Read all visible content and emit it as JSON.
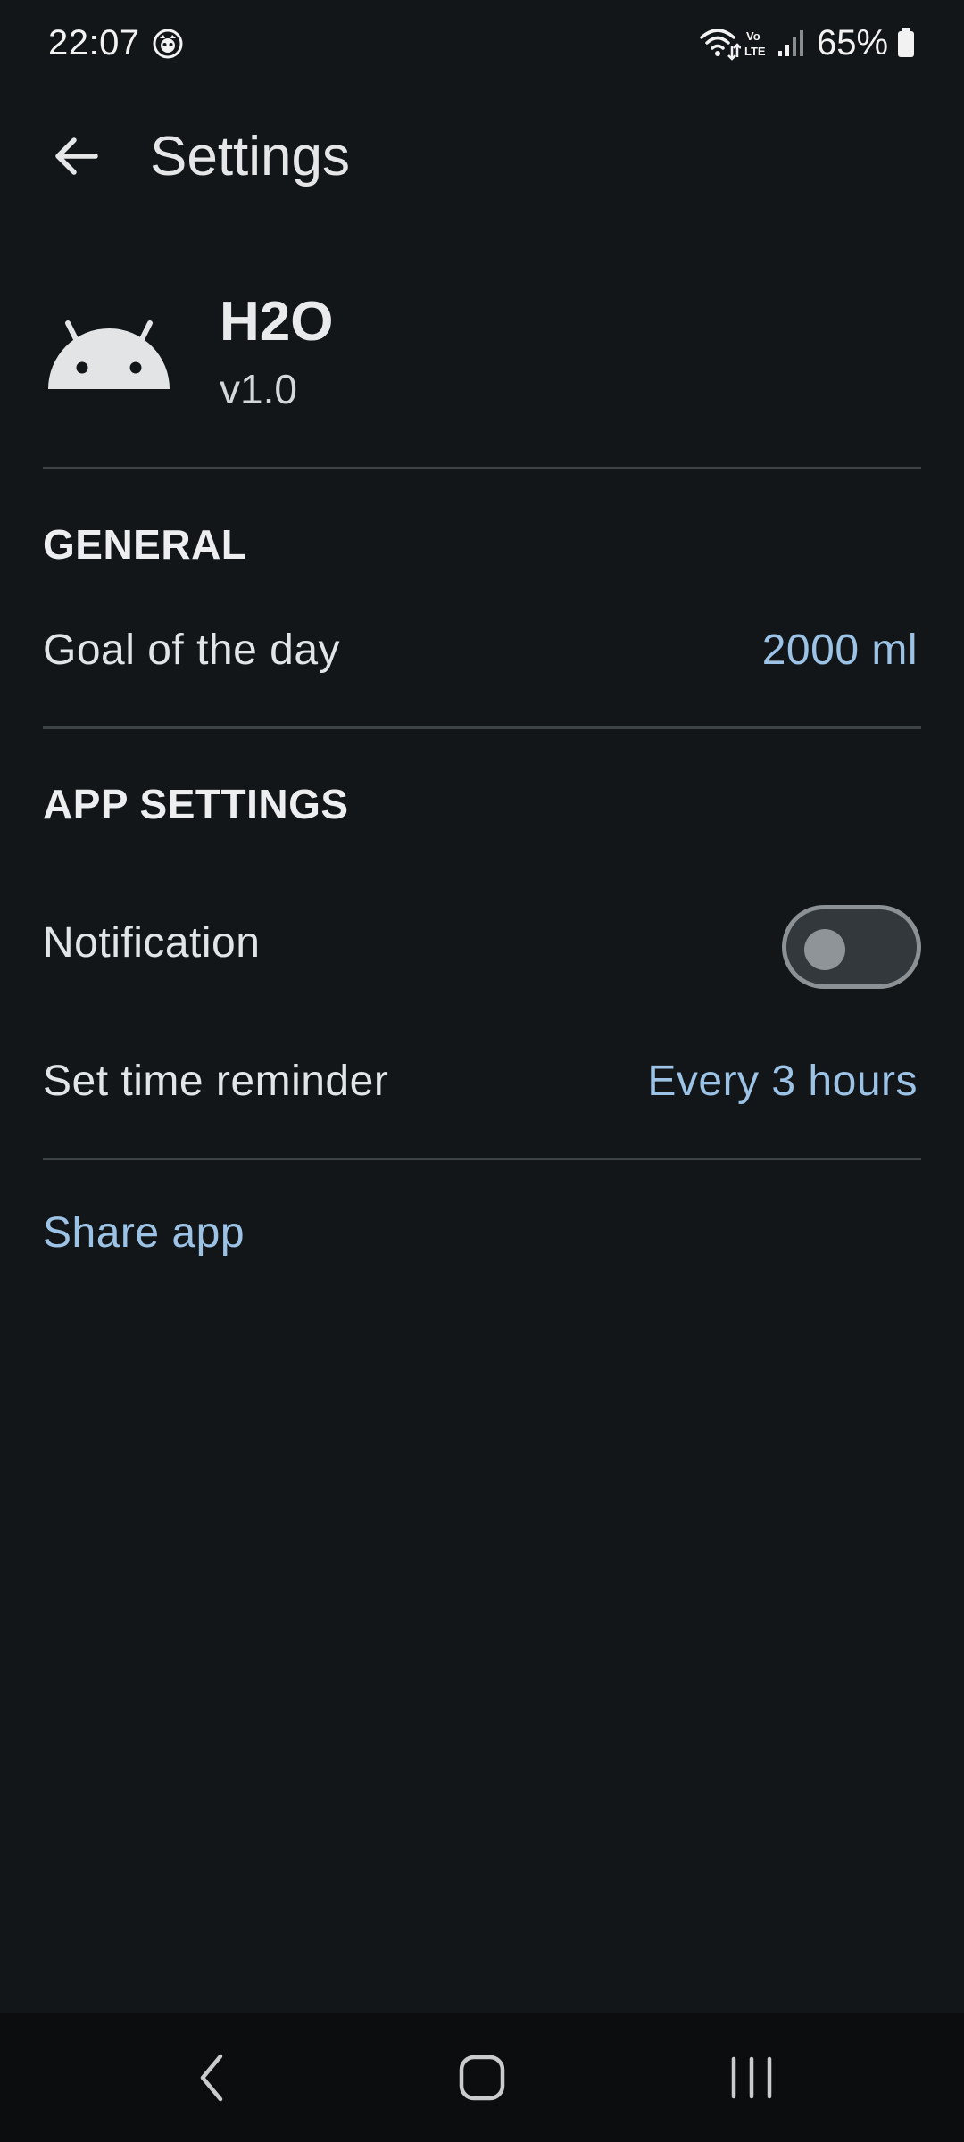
{
  "status_bar": {
    "time": "22:07",
    "battery_percent": "65%",
    "icons": [
      "notification-app-icon",
      "wifi-icon",
      "volte-icon",
      "signal-icon",
      "battery-icon"
    ]
  },
  "app_bar": {
    "title": "Settings",
    "back_icon": "arrow-back-icon"
  },
  "app_info": {
    "icon": "android-icon",
    "name": "H2O",
    "version": "v1.0"
  },
  "sections": {
    "general": {
      "header": "GENERAL",
      "goal": {
        "label": "Goal of the day",
        "value": "2000 ml"
      }
    },
    "app_settings": {
      "header": "APP SETTINGS",
      "notification": {
        "label": "Notification",
        "enabled": false
      },
      "reminder": {
        "label": "Set time reminder",
        "value": "Every 3 hours"
      }
    }
  },
  "share": {
    "label": "Share app"
  },
  "nav_bar": {
    "icons": [
      "nav-back-icon",
      "nav-home-icon",
      "nav-recents-icon"
    ]
  },
  "colors": {
    "background": "#121619",
    "accent": "#9cc3e6",
    "divider": "#3e4346",
    "nav_background": "#0b0d0f"
  }
}
